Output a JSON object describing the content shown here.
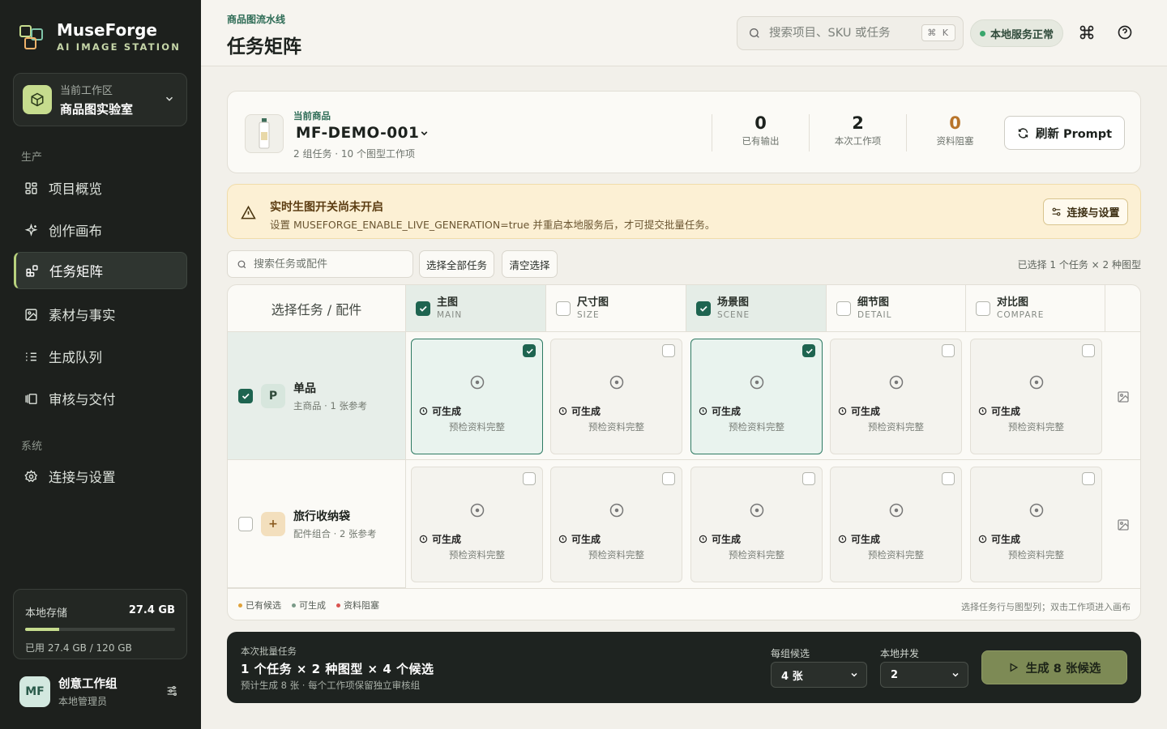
{
  "brand": {
    "name": "MuseForge",
    "subtitle": "AI IMAGE STATION"
  },
  "workspace": {
    "label": "当前工作区",
    "name": "商品图实验室"
  },
  "nav": {
    "section_production": "生产",
    "section_system": "系统",
    "items": [
      {
        "label": "项目概览",
        "icon": "grid-icon"
      },
      {
        "label": "创作画布",
        "icon": "sparkle-icon"
      },
      {
        "label": "任务矩阵",
        "icon": "matrix-icon",
        "active": true
      },
      {
        "label": "素材与事实",
        "icon": "image-icon"
      },
      {
        "label": "生成队列",
        "icon": "list-icon"
      },
      {
        "label": "审核与交付",
        "icon": "review-icon"
      }
    ],
    "system_items": [
      {
        "label": "连接与设置",
        "icon": "gear-icon"
      }
    ]
  },
  "storage": {
    "label": "本地存储",
    "value": "27.4 GB",
    "detail": "已用 27.4 GB / 120 GB",
    "used_fraction": 0.228
  },
  "user": {
    "initials": "MF",
    "name": "创意工作组",
    "role": "本地管理员"
  },
  "header": {
    "breadcrumb": "商品图流水线",
    "title": "任务矩阵",
    "search_placeholder": "搜索项目、SKU 或任务",
    "shortcut": "⌘ K",
    "status": "本地服务正常"
  },
  "product": {
    "label": "当前商品",
    "name": "MF-DEMO-001",
    "meta": "2 组任务 · 10 个图型工作项",
    "stats": [
      {
        "value": "0",
        "label": "已有输出"
      },
      {
        "value": "2",
        "label": "本次工作项"
      },
      {
        "value": "0",
        "label": "资料阻塞"
      }
    ],
    "refresh_label": "刷新 Prompt"
  },
  "warning": {
    "title": "实时生图开关尚未开启",
    "text": "设置 MUSEFORGE_ENABLE_LIVE_GENERATION=true 并重启本地服务后，才可提交批量任务。",
    "button": "连接与设置"
  },
  "toolbar": {
    "search_placeholder": "搜索任务或配件",
    "select_all": "选择全部任务",
    "clear": "清空选择",
    "summary": "已选择 1 个任务 × 2 种图型"
  },
  "matrix": {
    "corner": "选择任务 / 配件",
    "columns": [
      {
        "title": "主图",
        "sub": "MAIN",
        "selected": true
      },
      {
        "title": "尺寸图",
        "sub": "SIZE",
        "selected": false
      },
      {
        "title": "场景图",
        "sub": "SCENE",
        "selected": true
      },
      {
        "title": "细节图",
        "sub": "DETAIL",
        "selected": false
      },
      {
        "title": "对比图",
        "sub": "COMPARE",
        "selected": false
      }
    ],
    "rows": [
      {
        "badge": "P",
        "name": "单品",
        "meta": "主商品 · 1 张参考",
        "selected": true
      },
      {
        "badge": "+",
        "name": "旅行收纳袋",
        "meta": "配件组合 · 2 张参考",
        "selected": false
      }
    ],
    "cell_status": "可生成",
    "cell_note": "预检资料完整",
    "legend": [
      {
        "label": "已有候选",
        "color": "#e0a23a"
      },
      {
        "label": "可生成",
        "color": "#7a9a88"
      },
      {
        "label": "资料阻塞",
        "color": "#d9534f"
      }
    ],
    "hint": "选择任务行与图型列；双击工作项进入画布"
  },
  "batch": {
    "label": "本次批量任务",
    "title": "1 个任务 × 2 种图型 × 4 个候选",
    "note": "预计生成 8 张 · 每个工作项保留独立审核组",
    "per_group_label": "每组候选",
    "per_group_value": "4 张",
    "concurrency_label": "本地并发",
    "concurrency_value": "2",
    "generate": "生成 8 张候选"
  }
}
